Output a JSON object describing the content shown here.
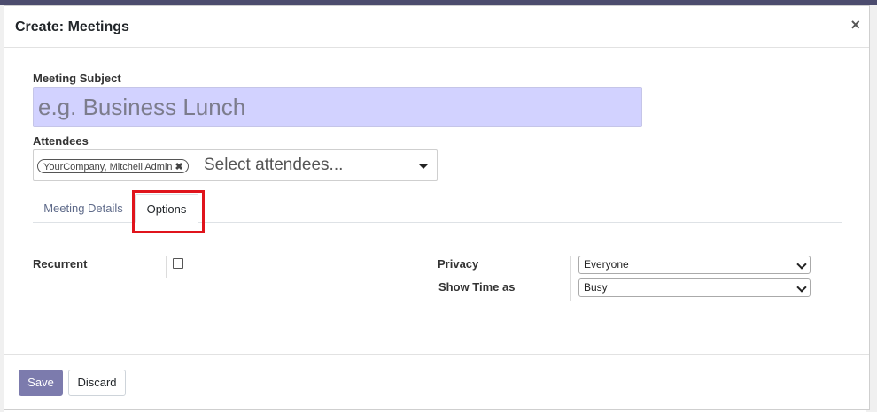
{
  "dialog": {
    "title": "Create: Meetings",
    "close_glyph": "×"
  },
  "form": {
    "subject_label": "Meeting Subject",
    "subject_placeholder": "e.g. Business Lunch",
    "subject_value": "",
    "attendees_label": "Attendees",
    "attendee_tag": "YourCompany, Mitchell Admin",
    "attendee_tag_remove": "✖",
    "attendees_placeholder": "Select attendees..."
  },
  "tabs": [
    {
      "label": "Meeting Details",
      "active": false
    },
    {
      "label": "Options",
      "active": true
    }
  ],
  "options": {
    "recurrent_label": "Recurrent",
    "recurrent_checked": false,
    "privacy_label": "Privacy",
    "privacy_value": "Everyone",
    "show_time_label": "Show Time as",
    "show_time_value": "Busy"
  },
  "footer": {
    "save_label": "Save",
    "discard_label": "Discard"
  },
  "colors": {
    "primary": "#7c7bad",
    "subject_bg": "#d2d2ff",
    "highlight": "#e0141c"
  }
}
